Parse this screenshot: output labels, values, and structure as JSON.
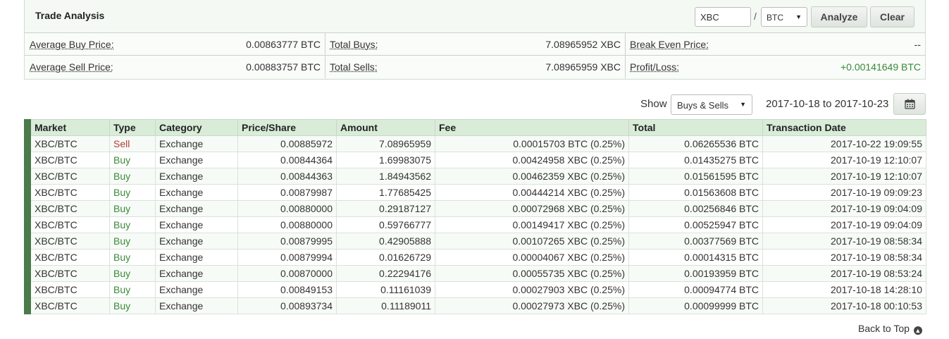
{
  "panel": {
    "title": "Trade Analysis",
    "pair_value": "XBC",
    "slash": "/",
    "base_selected": "BTC",
    "analyze_label": "Analyze",
    "clear_label": "Clear"
  },
  "stats": {
    "avg_buy_label": "Average Buy Price:",
    "avg_buy_value": "0.00863777 BTC",
    "total_buys_label": "Total Buys:",
    "total_buys_value": "7.08965952 XBC",
    "break_even_label": "Break Even Price:",
    "break_even_value": "--",
    "avg_sell_label": "Average Sell Price:",
    "avg_sell_value": "0.00883757 BTC",
    "total_sells_label": "Total Sells:",
    "total_sells_value": "7.08965959 XBC",
    "profit_label": "Profit/Loss:",
    "profit_value": "+0.00141649 BTC"
  },
  "filter": {
    "show_label": "Show",
    "show_selected": "Buys & Sells",
    "date_range": "2017-10-18 to 2017-10-23"
  },
  "colors": {
    "buy": "#3a8a3a",
    "sell": "#b33a3a",
    "row_stripe": "#4b7a4b",
    "header_bg": "#d8ecd8"
  },
  "table": {
    "columns": [
      "Market",
      "Type",
      "Category",
      "Price/Share",
      "Amount",
      "Fee",
      "Total",
      "Transaction Date"
    ],
    "rows": [
      [
        "XBC/BTC",
        "Sell",
        "Exchange",
        "0.00885972",
        "7.08965959",
        "0.00015703 BTC (0.25%)",
        "0.06265536 BTC",
        "2017-10-22 19:09:55"
      ],
      [
        "XBC/BTC",
        "Buy",
        "Exchange",
        "0.00844364",
        "1.69983075",
        "0.00424958 XBC (0.25%)",
        "0.01435275 BTC",
        "2017-10-19 12:10:07"
      ],
      [
        "XBC/BTC",
        "Buy",
        "Exchange",
        "0.00844363",
        "1.84943562",
        "0.00462359 XBC (0.25%)",
        "0.01561595 BTC",
        "2017-10-19 12:10:07"
      ],
      [
        "XBC/BTC",
        "Buy",
        "Exchange",
        "0.00879987",
        "1.77685425",
        "0.00444214 XBC (0.25%)",
        "0.01563608 BTC",
        "2017-10-19 09:09:23"
      ],
      [
        "XBC/BTC",
        "Buy",
        "Exchange",
        "0.00880000",
        "0.29187127",
        "0.00072968 XBC (0.25%)",
        "0.00256846 BTC",
        "2017-10-19 09:04:09"
      ],
      [
        "XBC/BTC",
        "Buy",
        "Exchange",
        "0.00880000",
        "0.59766777",
        "0.00149417 XBC (0.25%)",
        "0.00525947 BTC",
        "2017-10-19 09:04:09"
      ],
      [
        "XBC/BTC",
        "Buy",
        "Exchange",
        "0.00879995",
        "0.42905888",
        "0.00107265 XBC (0.25%)",
        "0.00377569 BTC",
        "2017-10-19 08:58:34"
      ],
      [
        "XBC/BTC",
        "Buy",
        "Exchange",
        "0.00879994",
        "0.01626729",
        "0.00004067 XBC (0.25%)",
        "0.00014315 BTC",
        "2017-10-19 08:58:34"
      ],
      [
        "XBC/BTC",
        "Buy",
        "Exchange",
        "0.00870000",
        "0.22294176",
        "0.00055735 XBC (0.25%)",
        "0.00193959 BTC",
        "2017-10-19 08:53:24"
      ],
      [
        "XBC/BTC",
        "Buy",
        "Exchange",
        "0.00849153",
        "0.11161039",
        "0.00027903 XBC (0.25%)",
        "0.00094774 BTC",
        "2017-10-18 14:28:10"
      ],
      [
        "XBC/BTC",
        "Buy",
        "Exchange",
        "0.00893734",
        "0.11189011",
        "0.00027973 XBC (0.25%)",
        "0.00099999 BTC",
        "2017-10-18 00:10:53"
      ]
    ]
  },
  "footer": {
    "back_to_top": "Back to Top",
    "back_to_top_icon": "arrow-up-circle-icon"
  }
}
